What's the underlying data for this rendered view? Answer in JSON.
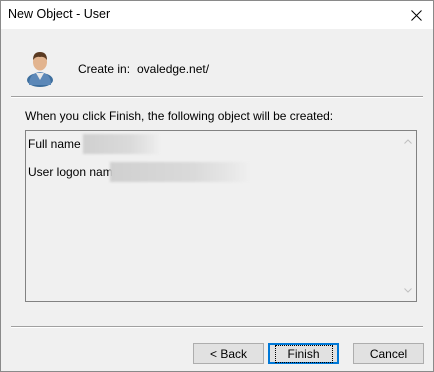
{
  "window": {
    "title": "New Object - User"
  },
  "header": {
    "create_in_label": "Create in:",
    "create_in_value": "ovaledge.net/"
  },
  "content": {
    "intro_text": "When you click Finish, the following object will be created:",
    "summary": {
      "full_name_label": "Full name",
      "logon_name_label": "User logon name:"
    }
  },
  "buttons": {
    "back": "< Back",
    "finish": "Finish",
    "cancel": "Cancel"
  },
  "icons": {
    "close": "close-icon",
    "user": "user-icon",
    "scroll_up": "scroll-up-arrow",
    "scroll_down": "scroll-down-arrow"
  },
  "colors": {
    "accent": "#0078d7",
    "dialog_bg": "#f0f0f0"
  }
}
